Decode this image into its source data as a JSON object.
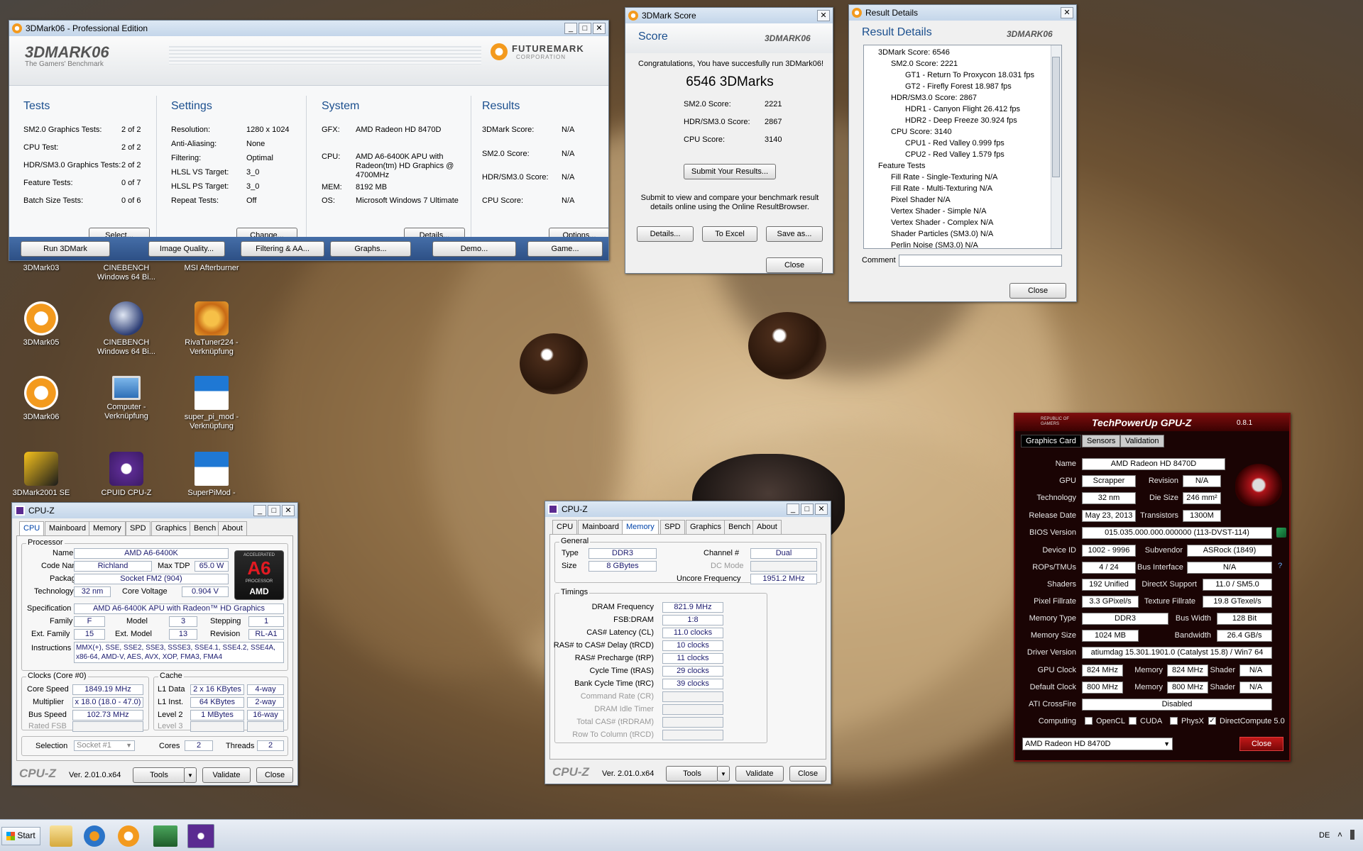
{
  "desktop": {
    "icons": [
      {
        "label": "3DMark03",
        "sub": ""
      },
      {
        "label": "CINEBENCH",
        "sub": "Windows 64 Bi..."
      },
      {
        "label": "MSI Afterburner",
        "sub": ""
      },
      {
        "label": "3DMark05",
        "sub": ""
      },
      {
        "label": "CINEBENCH",
        "sub": "Windows 64 Bi..."
      },
      {
        "label": "RivaTuner224 -",
        "sub": "Verknüpfung"
      },
      {
        "label": "3DMark06",
        "sub": ""
      },
      {
        "label": "Computer -",
        "sub": "Verknüpfung"
      },
      {
        "label": "super_pi_mod -",
        "sub": "Verknüpfung"
      },
      {
        "label": "3DMark2001 SE",
        "sub": ""
      },
      {
        "label": "CPUID CPU-Z",
        "sub": ""
      },
      {
        "label": "SuperPiMod -",
        "sub": ""
      }
    ]
  },
  "mark06": {
    "title": "3DMark06 - Professional Edition",
    "logo": "3DMARK06",
    "tagline": "The Gamers' Benchmark",
    "fm": "FUTUREMARK",
    "fm2": "CORPORATION",
    "tests": {
      "heading": "Tests",
      "rows": [
        [
          "SM2.0 Graphics Tests:",
          "2 of 2"
        ],
        [
          "CPU Test:",
          "2 of 2"
        ],
        [
          "HDR/SM3.0 Graphics Tests:",
          "2 of 2"
        ],
        [
          "Feature Tests:",
          "0 of 7"
        ],
        [
          "Batch Size Tests:",
          "0 of 6"
        ]
      ],
      "btn": "Select..."
    },
    "settings": {
      "heading": "Settings",
      "rows": [
        [
          "Resolution:",
          "1280 x 1024"
        ],
        [
          "Anti-Aliasing:",
          "None"
        ],
        [
          "Filtering:",
          "Optimal"
        ],
        [
          "HLSL VS Target:",
          "3_0"
        ],
        [
          "HLSL PS Target:",
          "3_0"
        ],
        [
          "Repeat Tests:",
          "Off"
        ]
      ],
      "btn": "Change..."
    },
    "system": {
      "heading": "System",
      "gfx_l": "GFX:",
      "gfx": "AMD Radeon HD 8470D",
      "cpu_l": "CPU:",
      "cpu1": "AMD A6-6400K APU with",
      "cpu2": "Radeon(tm) HD Graphics    @",
      "cpu3": "4700MHz",
      "mem_l": "MEM:",
      "mem": "8192 MB",
      "os_l": "OS:",
      "os": "Microsoft Windows 7 Ultimate",
      "btn": "Details..."
    },
    "results": {
      "heading": "Results",
      "rows": [
        [
          "3DMark Score:",
          "N/A"
        ],
        [
          "SM2.0 Score:",
          "N/A"
        ],
        [
          "HDR/SM3.0 Score:",
          "N/A"
        ],
        [
          "CPU Score:",
          "N/A"
        ]
      ],
      "btn": "Options..."
    },
    "bottom": [
      "Run 3DMark",
      "Image Quality...",
      "Filtering & AA...",
      "Graphs...",
      "Demo...",
      "Game..."
    ]
  },
  "score": {
    "title": "3DMark Score",
    "heading": "Score",
    "logo": "3DMARK06",
    "congrats": "Congratulations, You have succesfully run 3DMark06!",
    "marks": "6546 3DMarks",
    "rows": [
      [
        "SM2.0 Score:",
        "2221"
      ],
      [
        "HDR/SM3.0 Score:",
        "2867"
      ],
      [
        "CPU Score:",
        "3140"
      ]
    ],
    "submit": "Submit Your Results...",
    "info1": "Submit to view and compare your benchmark result",
    "info2": "details online using the Online ResultBrowser.",
    "b_details": "Details...",
    "b_excel": "To Excel",
    "b_save": "Save as...",
    "b_close": "Close"
  },
  "details": {
    "title": "Result Details",
    "heading": "Result Details",
    "logo": "3DMARK06",
    "tree": [
      "3DMark Score: 6546",
      "SM2.0 Score: 2221",
      "GT1 - Return To Proxycon   18.031 fps",
      "GT2 - Firefly Forest   18.987 fps",
      "HDR/SM3.0 Score: 2867",
      "HDR1 - Canyon Flight   26.412 fps",
      "HDR2 - Deep Freeze   30.924 fps",
      "CPU Score: 3140",
      "CPU1 - Red Valley   0.999 fps",
      "CPU2 - Red Valley   1.579 fps",
      "Feature Tests",
      "Fill Rate - Single-Texturing   N/A",
      "Fill Rate - Multi-Texturing   N/A",
      "Pixel Shader   N/A",
      "Vertex Shader - Simple   N/A",
      "Vertex Shader - Complex   N/A",
      "Shader Particles (SM3.0)   N/A",
      "Perlin Noise (SM3.0)   N/A"
    ],
    "comment": "Comment",
    "close": "Close"
  },
  "cpuz1": {
    "title": "CPU-Z",
    "tabs": [
      "CPU",
      "Mainboard",
      "Memory",
      "SPD",
      "Graphics",
      "Bench",
      "About"
    ],
    "processor": "Processor",
    "name_l": "Name",
    "name": "AMD A6-6400K",
    "code_l": "Code Name",
    "code": "Richland",
    "tdp_l": "Max TDP",
    "tdp": "65.0 W",
    "pkg_l": "Package",
    "pkg": "Socket FM2 (904)",
    "tech_l": "Technology",
    "tech": "32 nm",
    "cv_l": "Core Voltage",
    "cv": "0.904 V",
    "spec_l": "Specification",
    "spec": "AMD A6-6400K APU with Radeon™ HD Graphics",
    "fam_l": "Family",
    "fam": "F",
    "mod_l": "Model",
    "mod": "3",
    "step_l": "Stepping",
    "step": "1",
    "efam_l": "Ext. Family",
    "efam": "15",
    "emod_l": "Ext. Model",
    "emod": "13",
    "rev_l": "Revision",
    "rev": "RL-A1",
    "ins_l": "Instructions",
    "ins1": "MMX(+), SSE, SSE2, SSE3, SSSE3, SSE4.1, SSE4.2, SSE4A,",
    "ins2": "x86-64, AMD-V, AES, AVX, XOP, FMA3, FMA4",
    "clocks": "Clocks (Core #0)",
    "cs_l": "Core Speed",
    "cs": "1849.19 MHz",
    "mul_l": "Multiplier",
    "mul": "x 18.0 (18.0 - 47.0)",
    "bus_l": "Bus Speed",
    "bus": "102.73 MHz",
    "fsb_l": "Rated FSB",
    "cache": "Cache",
    "l1d_l": "L1 Data",
    "l1d": "2 x 16 KBytes",
    "l1d_w": "4-way",
    "l1i_l": "L1 Inst.",
    "l1i": "64 KBytes",
    "l1i_w": "2-way",
    "l2_l": "Level 2",
    "l2": "1 MBytes",
    "l2_w": "16-way",
    "l3_l": "Level 3",
    "sel_l": "Selection",
    "sel": "Socket #1",
    "cores_l": "Cores",
    "cores": "2",
    "thr_l": "Threads",
    "thr": "2",
    "brand": "CPU-Z",
    "ver": "Ver. 2.01.0.x64",
    "tools": "Tools",
    "validate": "Validate",
    "close": "Close",
    "badge_top": "ACCELERATED",
    "badge": "A6",
    "badge2": "PROCESSOR",
    "badge3": "AMD"
  },
  "cpuz2": {
    "title": "CPU-Z",
    "tabs": [
      "CPU",
      "Mainboard",
      "Memory",
      "SPD",
      "Graphics",
      "Bench",
      "About"
    ],
    "general": "General",
    "type_l": "Type",
    "type": "DDR3",
    "ch_l": "Channel #",
    "ch": "Dual",
    "size_l": "Size",
    "size": "8 GBytes",
    "dc_l": "DC Mode",
    "unc_l": "Uncore Frequency",
    "unc": "1951.2 MHz",
    "timings": "Timings",
    "rows": [
      [
        "DRAM Frequency",
        "821.9 MHz"
      ],
      [
        "FSB:DRAM",
        "1:8"
      ],
      [
        "CAS# Latency (CL)",
        "11.0 clocks"
      ],
      [
        "RAS# to CAS# Delay (tRCD)",
        "10 clocks"
      ],
      [
        "RAS# Precharge (tRP)",
        "11 clocks"
      ],
      [
        "Cycle Time (tRAS)",
        "29 clocks"
      ],
      [
        "Bank Cycle Time (tRC)",
        "39 clocks"
      ],
      [
        "Command Rate (CR)",
        ""
      ],
      [
        "DRAM Idle Timer",
        ""
      ],
      [
        "Total CAS# (tRDRAM)",
        ""
      ],
      [
        "Row To Column (tRCD)",
        ""
      ]
    ],
    "brand": "CPU-Z",
    "ver": "Ver. 2.01.0.x64",
    "tools": "Tools",
    "validate": "Validate",
    "close": "Close"
  },
  "gpuz": {
    "rog": "REPUBLIC OF GAMERS",
    "title": "TechPowerUp GPU-Z",
    "ver": "0.8.1",
    "tabs": [
      "Graphics Card",
      "Sensors",
      "Validation"
    ],
    "name_l": "Name",
    "name": "AMD Radeon HD 8470D",
    "gpu_l": "GPU",
    "gpu": "Scrapper",
    "rev_l": "Revision",
    "rev": "N/A",
    "tech_l": "Technology",
    "tech": "32 nm",
    "die_l": "Die Size",
    "die": "246 mm²",
    "rel_l": "Release Date",
    "rel": "May 23, 2013",
    "tr_l": "Transistors",
    "tr": "1300M",
    "bios_l": "BIOS Version",
    "bios": "015.035.000.000.000000 (113-DVST-114)",
    "dev_l": "Device ID",
    "dev": "1002 - 9996",
    "sub_l": "Subvendor",
    "sub": "ASRock (1849)",
    "rops_l": "ROPs/TMUs",
    "rops": "4 / 24",
    "bi_l": "Bus Interface",
    "bi": "N/A",
    "sh_l": "Shaders",
    "sh": "192 Unified",
    "dx_l": "DirectX Support",
    "dx": "11.0 / SM5.0",
    "pf_l": "Pixel Fillrate",
    "pf": "3.3 GPixel/s",
    "tf_l": "Texture Fillrate",
    "tf": "19.8 GTexel/s",
    "mt_l": "Memory Type",
    "mt": "DDR3",
    "bw_l": "Bus Width",
    "bw": "128 Bit",
    "ms_l": "Memory Size",
    "ms": "1024 MB",
    "band_l": "Bandwidth",
    "band": "26.4 GB/s",
    "drv_l": "Driver Version",
    "drv": "atiumdag 15.301.1901.0 (Catalyst 15.8) / Win7 64",
    "gc_l": "GPU Clock",
    "gc": "824 MHz",
    "mem_l": "Memory",
    "gcm": "824 MHz",
    "shd_l": "Shader",
    "gcs": "N/A",
    "dc_l": "Default Clock",
    "dc": "800 MHz",
    "dcm": "800 MHz",
    "dcs": "N/A",
    "cf_l": "ATI CrossFire",
    "cf": "Disabled",
    "comp_l": "Computing",
    "opencl": "OpenCL",
    "cuda": "CUDA",
    "physx": "PhysX",
    "dcomp": "DirectCompute 5.0",
    "select": "AMD Radeon HD 8470D",
    "close": "Close"
  },
  "taskbar": {
    "start": "Start",
    "lang": "DE"
  }
}
